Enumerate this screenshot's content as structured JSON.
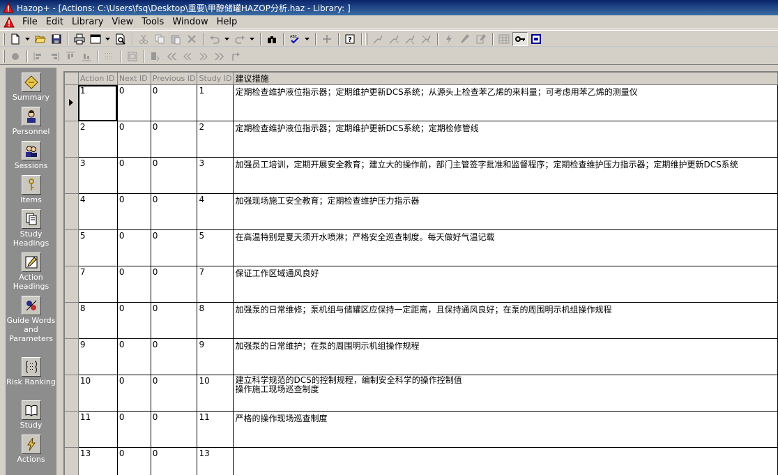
{
  "window": {
    "title": "Hazop+ - [Actions: C:\\Users\\fsq\\Desktop\\重要\\甲醇储罐HAZOP分析.haz - Library: ]"
  },
  "menu": [
    "File",
    "Edit",
    "Library",
    "View",
    "Tools",
    "Window",
    "Help"
  ],
  "sidebar": [
    {
      "label": "Summary",
      "icon": "summary-icon"
    },
    {
      "label": "Personnel",
      "icon": "person-icon"
    },
    {
      "label": "Sessions",
      "icon": "people-icon"
    },
    {
      "label": "Items",
      "icon": "key-icon"
    },
    {
      "label": "Study Headings",
      "icon": "study-headings-icon"
    },
    {
      "label": "Action Headings",
      "icon": "action-headings-icon"
    },
    {
      "label": "Guide Words and Parameters",
      "icon": "guide-words-icon"
    },
    {
      "label": "Risk Ranking",
      "icon": "risk-ranking-icon"
    },
    {
      "label": "Study",
      "icon": "book-icon"
    },
    {
      "label": "Actions",
      "icon": "actions-icon"
    }
  ],
  "grid": {
    "columns": [
      "Action ID",
      "Next ID",
      "Previous ID",
      "Study ID",
      "建议措施"
    ],
    "rows": [
      {
        "action_id": "1",
        "next_id": "0",
        "previous_id": "0",
        "study_id": "1",
        "text": "定期检查维护液位指示器；定期维护更新DCS系统；从源头上检查苯乙烯的来料量；可考虑用苯乙烯的测量仪"
      },
      {
        "action_id": "2",
        "next_id": "0",
        "previous_id": "0",
        "study_id": "2",
        "text": "定期检查维护液位指示器；定期维护更新DCS系统；定期检修管线"
      },
      {
        "action_id": "3",
        "next_id": "0",
        "previous_id": "0",
        "study_id": "3",
        "text": "加强员工培训，定期开展安全教育；建立大的操作前，部门主管签字批准和监督程序；定期检查维护压力指示器；定期维护更新DCS系统"
      },
      {
        "action_id": "4",
        "next_id": "0",
        "previous_id": "0",
        "study_id": "4",
        "text": "加强现场施工安全教育；定期检查维护压力指示器"
      },
      {
        "action_id": "5",
        "next_id": "0",
        "previous_id": "0",
        "study_id": "5",
        "text": "在高温特别是夏天须开水喷淋；严格安全巡查制度。每天做好气温记载"
      },
      {
        "action_id": "7",
        "next_id": "0",
        "previous_id": "0",
        "study_id": "7",
        "text": "保证工作区域通风良好"
      },
      {
        "action_id": "8",
        "next_id": "0",
        "previous_id": "0",
        "study_id": "8",
        "text": "加强泵的日常维修；泵机组与储罐区应保持一定距离，且保持通风良好；在泵的周围明示机组操作规程"
      },
      {
        "action_id": "9",
        "next_id": "0",
        "previous_id": "0",
        "study_id": "9",
        "text": "加强泵的日常维护；在泵的周围明示机组操作规程"
      },
      {
        "action_id": "10",
        "next_id": "0",
        "previous_id": "0",
        "study_id": "10",
        "text": "建立科学规范的DCS的控制规程，编制安全科学的操作控制值\n操作施工现场巡查制度"
      },
      {
        "action_id": "11",
        "next_id": "0",
        "previous_id": "0",
        "study_id": "11",
        "text": "严格的操作现场巡查制度"
      },
      {
        "action_id": "13",
        "next_id": "0",
        "previous_id": "0",
        "study_id": "13",
        "text": ""
      }
    ]
  }
}
